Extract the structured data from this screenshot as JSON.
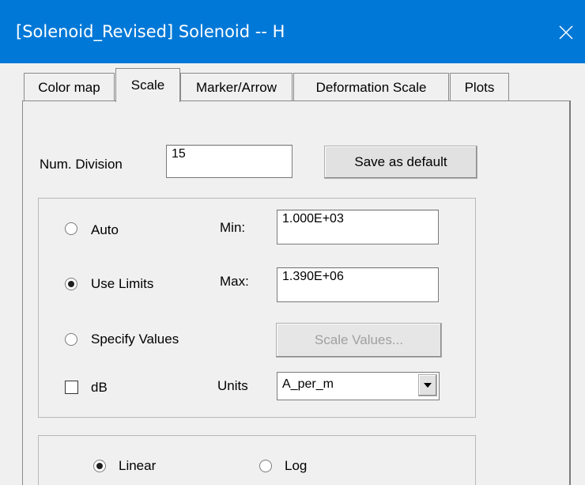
{
  "window": {
    "title": "[Solenoid_Revised] Solenoid -- H"
  },
  "tabs": [
    "Color map",
    "Scale",
    "Marker/Arrow",
    "Deformation Scale",
    "Plots"
  ],
  "scale": {
    "num_division_label": "Num. Division",
    "num_division_value": "15",
    "save_default_label": "Save as default",
    "limits": {
      "auto_label": "Auto",
      "use_limits_label": "Use Limits",
      "specify_values_label": "Specify Values",
      "db_label": "dB",
      "min_label": "Min:",
      "min_value": "1.000E+03",
      "max_label": "Max:",
      "max_value": "1.390E+06",
      "scale_values_label": "Scale Values...",
      "units_label": "Units",
      "units_value": "A_per_m",
      "selected": "Use Limits",
      "db_checked": false
    },
    "scale_type": {
      "linear_label": "Linear",
      "log_label": "Log",
      "selected": "Linear"
    }
  }
}
